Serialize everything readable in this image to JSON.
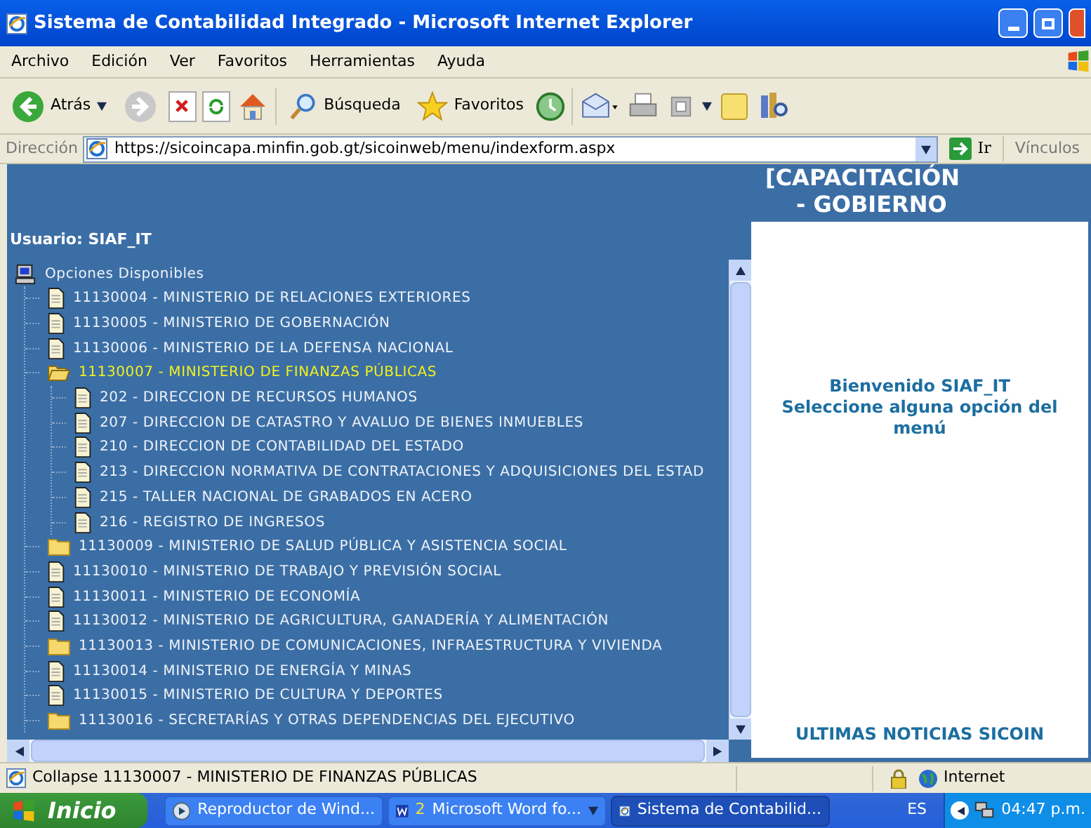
{
  "window": {
    "title": "Sistema de Contabilidad Integrado - Microsoft Internet Explorer"
  },
  "menu": [
    "Archivo",
    "Edición",
    "Ver",
    "Favoritos",
    "Herramientas",
    "Ayuda"
  ],
  "toolbar": {
    "back": "Atrás",
    "search": "Búsqueda",
    "favorites": "Favoritos"
  },
  "address": {
    "label": "Dirección",
    "value": "https://sicoincapa.minfin.gob.gt/sicoinweb/menu/indexform.aspx",
    "go": "Ir",
    "links": "Vínculos"
  },
  "header": [
    "[CAPACITACIÓN",
    "- GOBIERNO"
  ],
  "user": "Usuario: SIAF_IT",
  "tree": {
    "label": "Opciones Disponibles",
    "children": [
      {
        "kind": "document",
        "label": "11130004 - MINISTERIO DE RELACIONES EXTERIORES",
        "selected": false
      },
      {
        "kind": "document",
        "label": "11130005 - MINISTERIO DE GOBERNACIÓN",
        "selected": false
      },
      {
        "kind": "document",
        "label": "11130006 - MINISTERIO DE LA DEFENSA NACIONAL",
        "selected": false
      },
      {
        "kind": "folder",
        "label": "11130007 - MINISTERIO DE FINANZAS PÚBLICAS",
        "selected": true,
        "expanded": true,
        "children": [
          {
            "kind": "document",
            "label": "202 - DIRECCION DE RECURSOS HUMANOS",
            "selected": false
          },
          {
            "kind": "document",
            "label": "207 - DIRECCION DE CATASTRO Y AVALUO DE BIENES INMUEBLES",
            "selected": false
          },
          {
            "kind": "document",
            "label": "210 - DIRECCION DE CONTABILIDAD DEL ESTADO",
            "selected": false
          },
          {
            "kind": "document",
            "label": "213 - DIRECCION NORMATIVA DE CONTRATACIONES Y ADQUISICIONES DEL ESTAD",
            "selected": false
          },
          {
            "kind": "document",
            "label": "215 - TALLER NACIONAL DE GRABADOS EN ACERO",
            "selected": false
          },
          {
            "kind": "document",
            "label": "216 - REGISTRO DE INGRESOS",
            "selected": false
          }
        ]
      },
      {
        "kind": "folder",
        "label": "11130009 - MINISTERIO DE SALUD PÚBLICA Y ASISTENCIA SOCIAL",
        "selected": false,
        "expanded": false
      },
      {
        "kind": "document",
        "label": "11130010 - MINISTERIO DE TRABAJO Y PREVISIÓN SOCIAL",
        "selected": false
      },
      {
        "kind": "document",
        "label": "11130011 - MINISTERIO DE ECONOMÍA",
        "selected": false
      },
      {
        "kind": "document",
        "label": "11130012 - MINISTERIO DE AGRICULTURA, GANADERÍA Y ALIMENTACIÓN",
        "selected": false
      },
      {
        "kind": "folder",
        "label": "11130013 - MINISTERIO DE COMUNICACIONES, INFRAESTRUCTURA Y VIVIENDA",
        "selected": false,
        "expanded": false
      },
      {
        "kind": "document",
        "label": "11130014 - MINISTERIO DE ENERGÍA Y MINAS",
        "selected": false
      },
      {
        "kind": "document",
        "label": "11130015 - MINISTERIO DE CULTURA Y DEPORTES",
        "selected": false
      },
      {
        "kind": "folder",
        "label": "11130016 - SECRETARÍAS Y OTRAS DEPENDENCIAS DEL EJECUTIVO",
        "selected": false,
        "expanded": false
      }
    ]
  },
  "welcome": [
    "Bienvenido SIAF_IT",
    "Seleccione alguna opción del menú"
  ],
  "news": "ULTIMAS NOTICIAS SICOIN",
  "status": {
    "text": "Collapse 11130007 - MINISTERIO DE FINANZAS PÚBLICAS",
    "zone": "Internet"
  },
  "taskbar": {
    "start": "Inicio",
    "tasks": [
      {
        "kind": "media",
        "label": "Reproductor de Wind...",
        "selected": false
      },
      {
        "kind": "word",
        "count": "2",
        "label": "Microsoft Word fo...",
        "selected": false
      },
      {
        "kind": "browser",
        "label": "Sistema de Contabilid...",
        "selected": true
      }
    ],
    "language": "ES",
    "clock": "04:47 p.m."
  }
}
